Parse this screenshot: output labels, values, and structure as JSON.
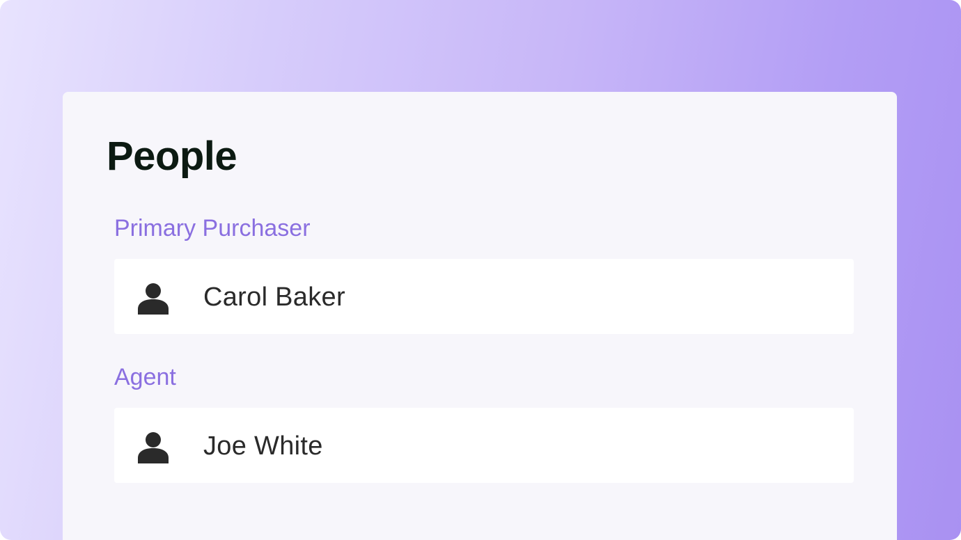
{
  "card": {
    "title": "People"
  },
  "sections": [
    {
      "label": "Primary Purchaser",
      "person": {
        "name": "Carol Baker",
        "icon": "person-icon"
      }
    },
    {
      "label": "Agent",
      "person": {
        "name": "Joe White",
        "icon": "person-icon"
      }
    }
  ],
  "colors": {
    "accent_label": "#8a6fe0",
    "title_text": "#0c1a12",
    "name_text": "#2a2a2a",
    "card_background": "#f7f6fb",
    "row_background": "#ffffff"
  }
}
